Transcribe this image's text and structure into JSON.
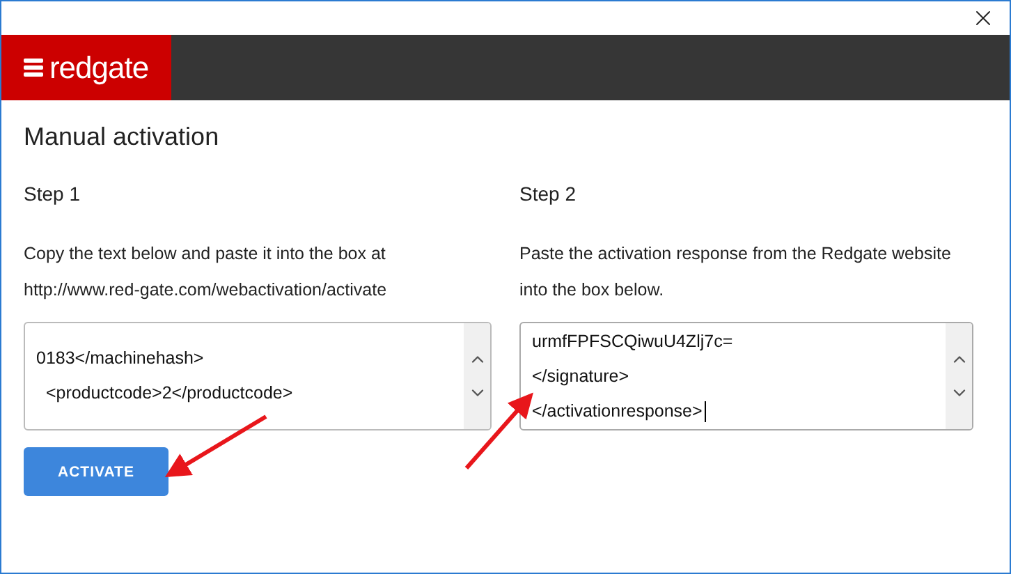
{
  "header": {
    "logo": "redgate"
  },
  "title": "Manual activation",
  "steps": [
    {
      "heading": "Step 1",
      "instructions": [
        "Copy the text below and paste it into the box at",
        "http://www.red-gate.com/webactivation/activate"
      ],
      "lines": [
        "0183</machinehash>",
        "  <productcode>2</productcode>"
      ],
      "focused": false
    },
    {
      "heading": "Step 2",
      "instructions": [
        "Paste the activation response from the Redgate website",
        "into the box below."
      ],
      "lines": [
        "urmfFPFSCQiwuU4Zlj7c=",
        "</signature>",
        "</activationresponse>"
      ],
      "focused": true
    }
  ],
  "button": "ACTIVATE"
}
